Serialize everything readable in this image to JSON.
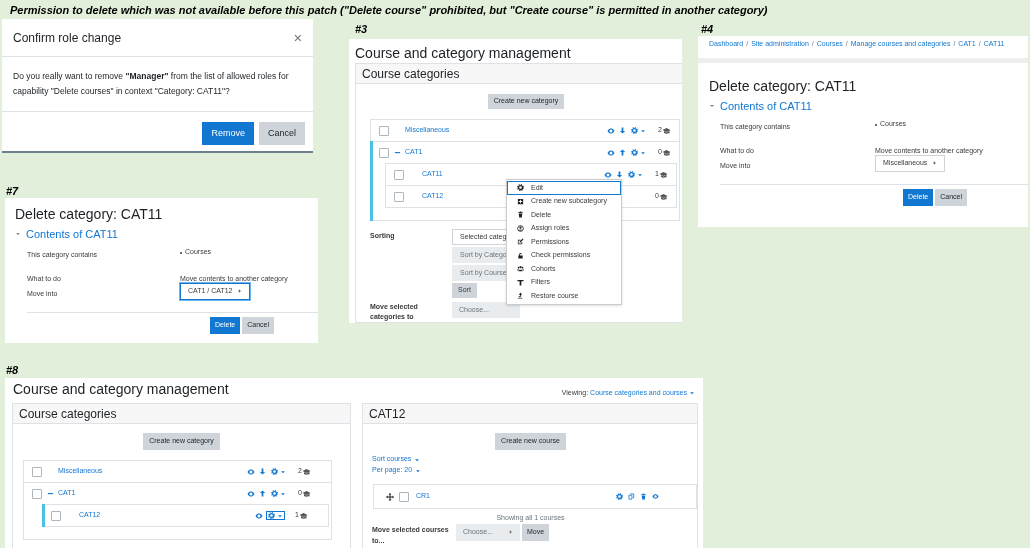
{
  "caption": "Permission to delete which was not available before this patch (\"Delete course\" prohibited, but \"Create course\" is permitted in another category)",
  "dialog": {
    "title": "Confirm role change",
    "close": "×",
    "message": "Do you really want to remove **\"Manager\"** from the list of allowed roles for capability \"Delete courses\" in context \"Category: CAT11\"?",
    "buttons": [
      {
        "label": "Remove",
        "kind": "primary"
      },
      {
        "label": "Cancel",
        "kind": "secondary"
      }
    ]
  },
  "screen_3": {
    "label": "#3",
    "title": "Course and category management",
    "card_title": "Course categories",
    "create_button": "Create new category",
    "categories": [
      {
        "name": "Miscellaneous",
        "checked": false,
        "active": false,
        "kind": "down",
        "count": "2"
      },
      {
        "name": "CAT1",
        "checked": false,
        "active": true,
        "expanded": true,
        "kind": "up",
        "count": "0",
        "children": [
          {
            "name": "CAT11",
            "checked": false,
            "active": false,
            "kind": "down",
            "count": "1"
          },
          {
            "name": "CAT12",
            "checked": false,
            "active": false,
            "kind": "covered",
            "count": "0"
          }
        ]
      }
    ],
    "sorting": {
      "label": "Sorting",
      "selects": [
        "Selected categ",
        "Sort by Catego",
        "Sort by Course"
      ],
      "button": "Sort"
    },
    "move": {
      "label": "Move selected categories to",
      "select": "Choose..."
    },
    "menu": [
      {
        "kind": "edit",
        "label": "Edit",
        "selected": true
      },
      {
        "kind": "create",
        "label": "Create new subcategory",
        "selected": false
      },
      {
        "kind": "delete",
        "label": "Delete",
        "selected": false
      },
      {
        "kind": "roles",
        "label": "Assign roles",
        "selected": false
      },
      {
        "kind": "permissions",
        "label": "Permissions",
        "selected": false
      },
      {
        "kind": "check",
        "label": "Check permissions",
        "selected": false
      },
      {
        "kind": "cohorts",
        "label": "Cohorts",
        "selected": false
      },
      {
        "kind": "filters",
        "label": "Filters",
        "selected": false
      },
      {
        "kind": "restore",
        "label": "Restore course",
        "selected": false
      }
    ]
  },
  "screen_4": {
    "label": "#4",
    "separator": "/",
    "breadcrumb": [
      "Dashboard",
      "Site administration",
      "Courses",
      "Manage courses and categories",
      "CAT1",
      "CAT11"
    ],
    "title": "Delete category: CAT11",
    "section": "Contents of CAT11",
    "rows": [
      {
        "label": "This category contains",
        "kind": "list",
        "value": "Courses"
      },
      {
        "label": "What to do",
        "kind": "text",
        "value": "Move contents to another category"
      },
      {
        "label": "Move into",
        "kind": "select",
        "value": "Miscellaneous",
        "focused": false
      }
    ],
    "buttons": [
      {
        "label": "Delete",
        "kind": "primary"
      },
      {
        "label": "Cancel",
        "kind": "secondary"
      }
    ]
  },
  "screen_7": {
    "label": "#7",
    "title": "Delete category: CAT11",
    "section": "Contents of CAT11",
    "rows": [
      {
        "label": "This category contains",
        "kind": "list",
        "value": "Courses"
      },
      {
        "label": "What to do",
        "kind": "text",
        "value": "Move contents to another category"
      },
      {
        "label": "Move into",
        "kind": "select",
        "value": "CAT1 / CAT12",
        "focused": true
      }
    ],
    "buttons": [
      {
        "label": "Delete",
        "kind": "primary"
      },
      {
        "label": "Cancel",
        "kind": "secondary"
      }
    ]
  },
  "screen_8": {
    "label": "#8",
    "title": "Course and category management",
    "viewing_label": "Viewing:",
    "viewing_value": "Course categories and courses",
    "card_title": "Course categories",
    "create_button": "Create new category",
    "categories": [
      {
        "name": "Miscellaneous",
        "checked": false,
        "active": false,
        "kind": "down",
        "count": "2",
        "gear_focused": false
      },
      {
        "name": "CAT1",
        "checked": false,
        "active": false,
        "expanded": true,
        "kind": "up",
        "count": "0",
        "gear_focused": false,
        "children": [
          {
            "name": "CAT12",
            "checked": false,
            "active": true,
            "kind": "plain",
            "count": "1",
            "gear_focused": true
          }
        ]
      }
    ],
    "course_card": {
      "title": "CAT12",
      "create_button": "Create new course",
      "links": [
        "Sort courses",
        "Per page: 20"
      ],
      "courses": [
        {
          "name": "CR1",
          "checked": false
        }
      ],
      "showing": "Showing all 1 courses",
      "move_label": "Move selected courses to...",
      "select": "Choose...",
      "move_button": "Move"
    }
  }
}
